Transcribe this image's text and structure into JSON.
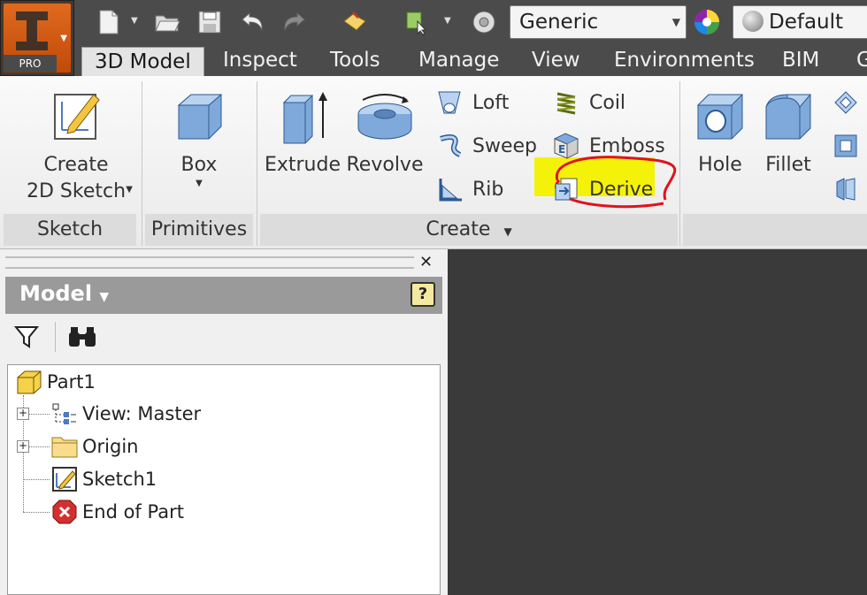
{
  "app": {
    "badge": "PRO"
  },
  "quick_access": {
    "material_value": "Generic",
    "appearance_value": "Default"
  },
  "tabs": [
    {
      "label": "3D Model",
      "active": true
    },
    {
      "label": "Inspect"
    },
    {
      "label": "Tools"
    },
    {
      "label": "Manage"
    },
    {
      "label": "View"
    },
    {
      "label": "Environments"
    },
    {
      "label": "BIM"
    },
    {
      "label": "G"
    }
  ],
  "ribbon": {
    "sketch": {
      "button_line1": "Create",
      "button_line2": "2D Sketch",
      "panel_title": "Sketch"
    },
    "primitives": {
      "button": "Box",
      "panel_title": "Primitives"
    },
    "create": {
      "extrude": "Extrude",
      "revolve": "Revolve",
      "loft": "Loft",
      "sweep": "Sweep",
      "rib": "Rib",
      "coil": "Coil",
      "emboss": "Emboss",
      "derive": "Derive",
      "panel_title": "Create"
    },
    "modify": {
      "hole": "Hole",
      "fillet": "Fillet"
    }
  },
  "browser": {
    "title": "Model",
    "help": "?",
    "tree": [
      {
        "label": "Part1"
      },
      {
        "label": "View: Master"
      },
      {
        "label": "Origin"
      },
      {
        "label": "Sketch1"
      },
      {
        "label": "End of Part"
      }
    ]
  },
  "colors": {
    "highlight": "#f5f20a",
    "annotation": "#e0121c",
    "viewport": "#3a3a3a",
    "tab_bar": "#4b4b4b"
  }
}
